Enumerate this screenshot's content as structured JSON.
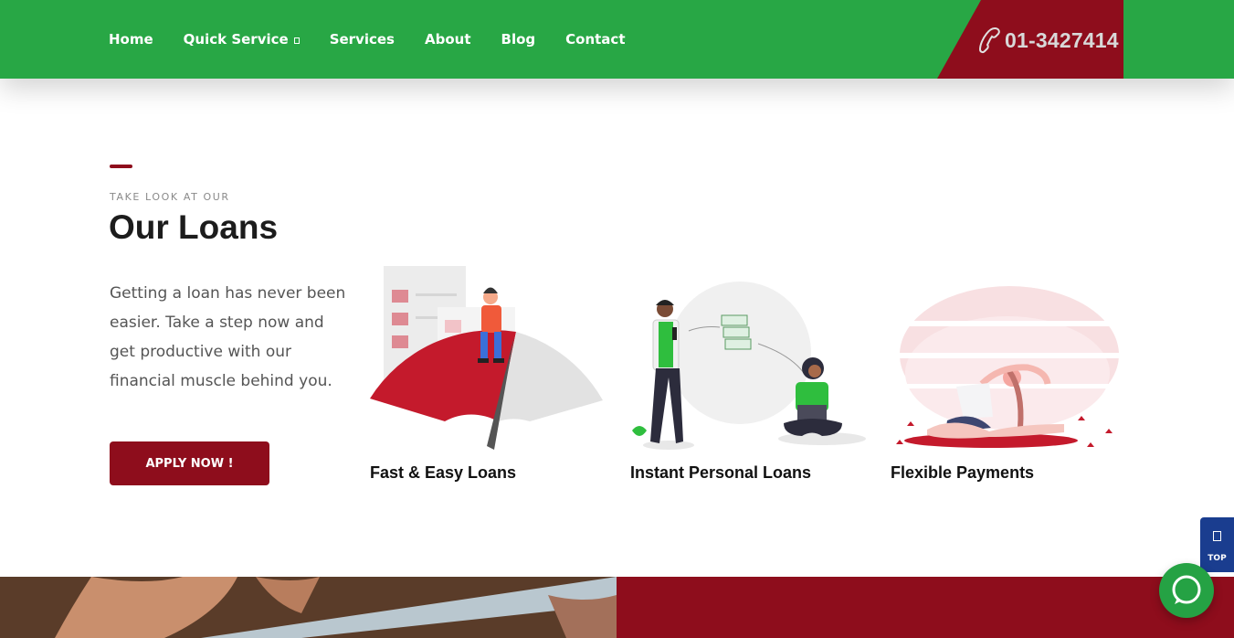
{
  "header": {
    "nav": [
      {
        "label": "Home"
      },
      {
        "label": "Quick Service"
      },
      {
        "label": "Services"
      },
      {
        "label": "About"
      },
      {
        "label": "Blog"
      },
      {
        "label": "Contact"
      }
    ],
    "phone": "01-3427414",
    "phone_icon": "phone-icon"
  },
  "loans_section": {
    "eyebrow": "TAKE LOOK AT OUR",
    "title": "Our Loans",
    "intro": "Getting a loan has never been easier. Take a step now and get productive with our financial muscle behind you.",
    "apply_label": "APPLY NOW !",
    "cards": [
      {
        "title": "Fast & Easy Loans"
      },
      {
        "title": "Instant Personal Loans"
      },
      {
        "title": "Flexible Payments"
      }
    ]
  },
  "floating": {
    "top_label": "TOP",
    "chat_icon": "chat-bubble-icon"
  },
  "colors": {
    "header_green": "#28a745",
    "brand_red": "#8e0d1c",
    "top_button_blue": "#1a3d8f"
  }
}
